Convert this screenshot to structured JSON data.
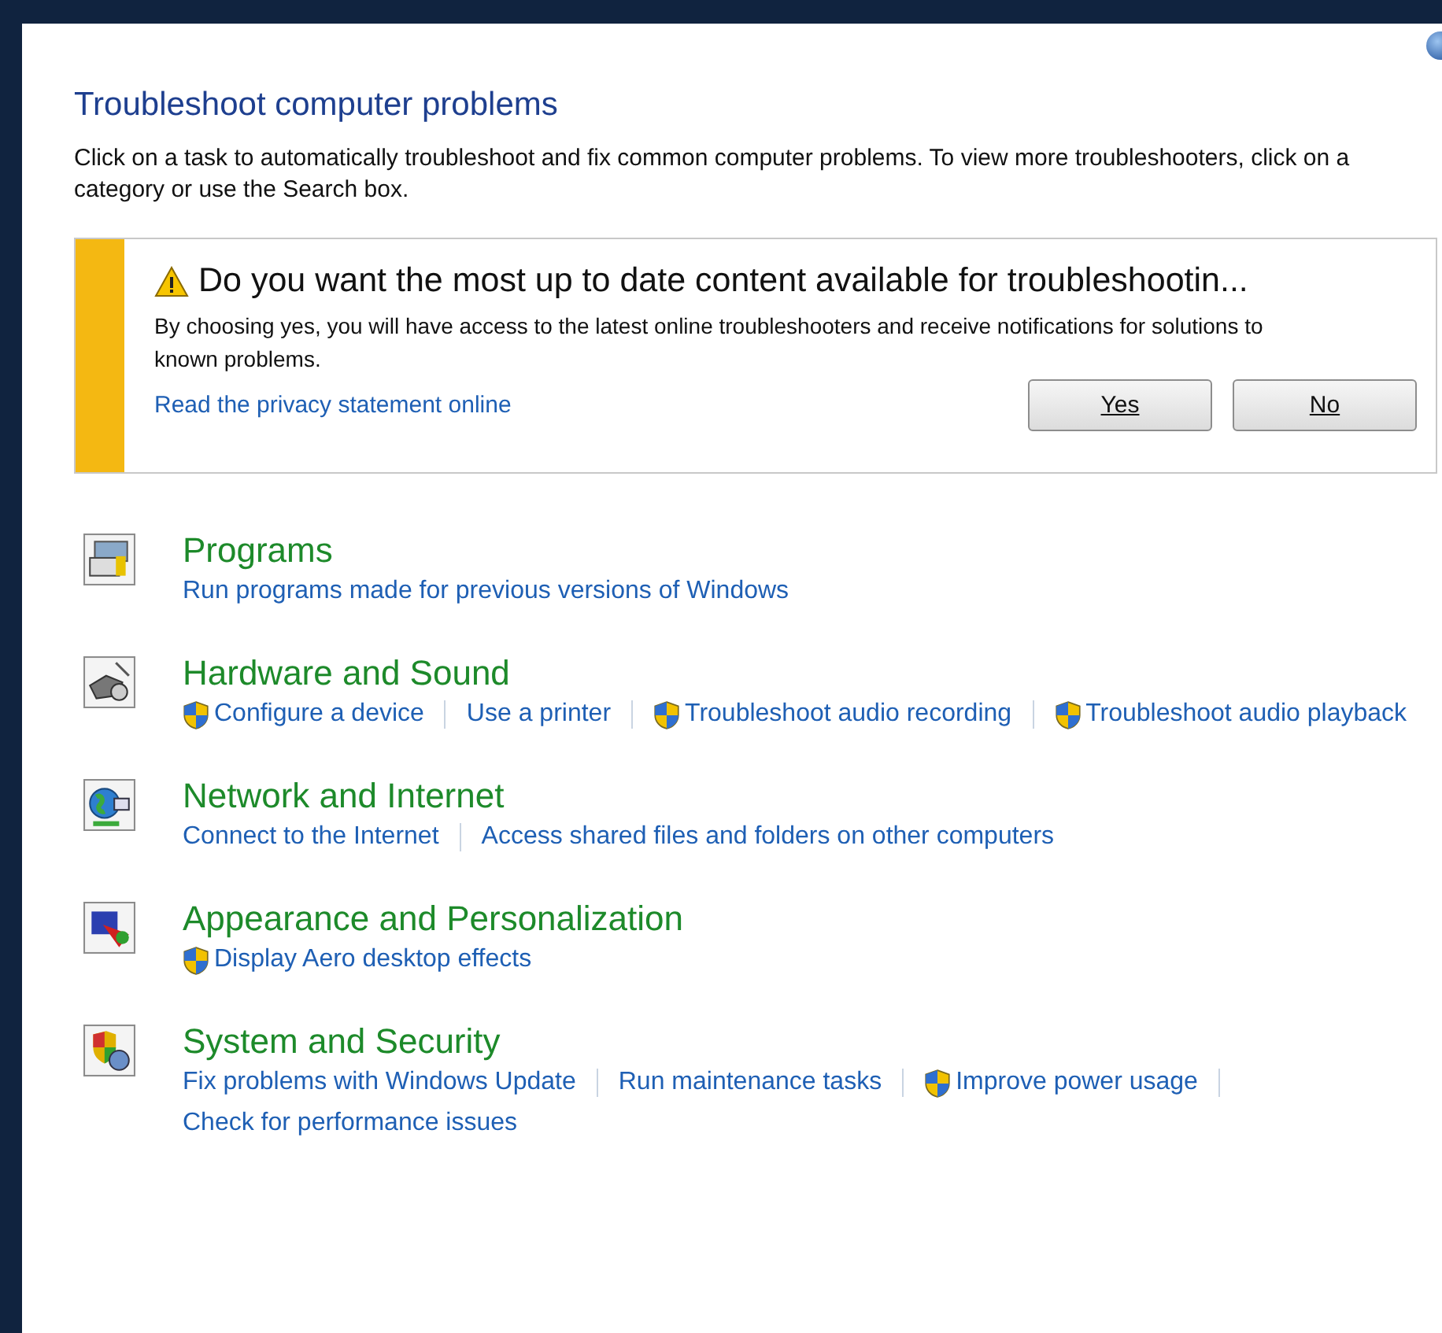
{
  "page": {
    "title": "Troubleshoot computer problems",
    "description": "Click on a task to automatically troubleshoot and fix common computer problems. To view more troubleshooters, click on a category or use the Search box."
  },
  "banner": {
    "heading": "Do you want the most up to date content available for troubleshootin...",
    "body": "By choosing yes, you will have access to the latest online troubleshooters and receive notifications for solutions to known problems.",
    "link": "Read the privacy statement online",
    "buttons": [
      {
        "label": "Yes"
      },
      {
        "label": "No"
      }
    ]
  },
  "categories": [
    {
      "kind": "programs",
      "title": "Programs",
      "links": [
        {
          "label": "Run programs made for previous versions of Windows",
          "shield": false
        }
      ]
    },
    {
      "kind": "hardware",
      "title": "Hardware and Sound",
      "links": [
        {
          "label": "Configure a device",
          "shield": true
        },
        {
          "label": "Use a printer",
          "shield": false
        },
        {
          "label": "Troubleshoot audio recording",
          "shield": true
        },
        {
          "label": "Troubleshoot audio playback",
          "shield": true
        }
      ]
    },
    {
      "kind": "network",
      "title": "Network and Internet",
      "links": [
        {
          "label": "Connect to the Internet",
          "shield": false
        },
        {
          "label": "Access shared files and folders on other computers",
          "shield": false
        }
      ]
    },
    {
      "kind": "appearance",
      "title": "Appearance and Personalization",
      "links": [
        {
          "label": "Display Aero desktop effects",
          "shield": true
        }
      ]
    },
    {
      "kind": "security",
      "title": "System and Security",
      "links": [
        {
          "label": "Fix problems with Windows Update",
          "shield": false
        },
        {
          "label": "Run maintenance tasks",
          "shield": false
        },
        {
          "label": "Improve power usage",
          "shield": true
        },
        {
          "label": "Check for performance issues",
          "shield": false
        }
      ]
    }
  ]
}
